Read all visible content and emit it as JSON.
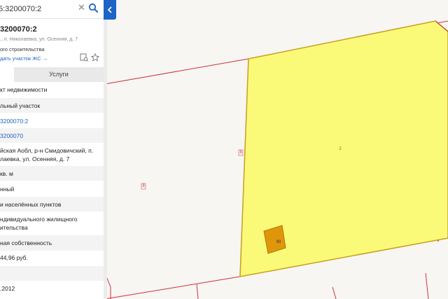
{
  "search": {
    "value": "5:3200070:2"
  },
  "object": {
    "title": "3200070:2",
    "address": "., п. Николаевка, ул. Осенняя, д. 7",
    "type": "ого строительства",
    "link": "дать участок ЖС →"
  },
  "tabs": {
    "left": "",
    "services": "Услуги"
  },
  "rows": [
    {
      "text": "кт недвижимости"
    },
    {
      "text": "льный участок"
    },
    {
      "text": "3200070:2"
    },
    {
      "text": "3200070"
    },
    {
      "line1": "йская Aобл, р-н Смидовичский, п.",
      "line2": "лаевка, ул. Осенняя, д. 7"
    },
    {
      "text": "кв. м"
    },
    {
      "text": "нный"
    },
    {
      "text": "и населённых пунктов"
    },
    {
      "line1": "ндивидуального жилищного",
      "line2": "ительства"
    },
    {
      "text": "ная собственность"
    },
    {
      "text": "44,96 руб."
    },
    {
      "text": ""
    },
    {
      "text": ".2012"
    }
  ],
  "map": {
    "labels": {
      "parcel_main": "2",
      "neighbor_left": "8",
      "neighbor_far": "8",
      "building": "90"
    },
    "colors": {
      "parcel_fill": "#fafa78",
      "boundary": "#d0303a",
      "building": "#e0960a",
      "background": "#f7f6f3"
    }
  }
}
